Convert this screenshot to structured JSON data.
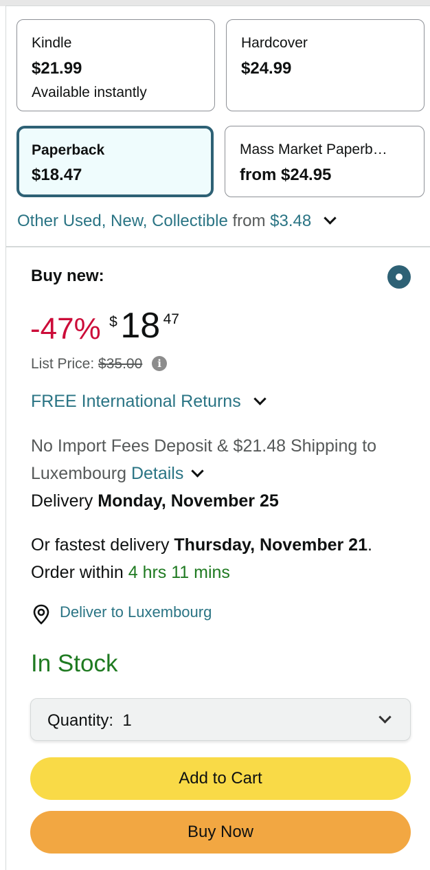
{
  "formats": [
    {
      "name": "Kindle",
      "price": "$21.99",
      "sub": "Available instantly",
      "selected": false
    },
    {
      "name": "Hardcover",
      "price": "$24.99",
      "sub": "",
      "selected": false
    },
    {
      "name": "Paperback",
      "price": "$18.47",
      "sub": "",
      "selected": true
    },
    {
      "name": "Mass Market Paperb…",
      "price": "from $24.95",
      "sub": "",
      "selected": false
    }
  ],
  "other_offers": {
    "link_text": "Other Used, New, Collectible",
    "from_text": "from",
    "price": "$3.48"
  },
  "buy_new": {
    "label": "Buy new:",
    "discount": "-47%",
    "currency": "$",
    "price_whole": "18",
    "price_fraction": "47",
    "list_price_label": "List Price:",
    "list_price": "$35.00",
    "info_icon": "i"
  },
  "returns": "FREE International Returns",
  "shipping": {
    "line1": "No Import Fees Deposit & $21.48 Shipping to Luxembourg",
    "details_link": "Details",
    "delivery_label": "Delivery",
    "delivery_date": "Monday, November 25",
    "fastest_prefix": "Or fastest delivery",
    "fastest_date": "Thursday, November 21",
    "order_within": ". Order within",
    "countdown": "4 hrs 11 mins"
  },
  "deliver_to": "Deliver to Luxembourg",
  "stock_status": "In Stock",
  "quantity": {
    "label": "Quantity:",
    "value": "1"
  },
  "buttons": {
    "add_to_cart": "Add to Cart",
    "buy_now": "Buy Now"
  },
  "colors": {
    "link": "#2a7484",
    "discount": "#cc0c39",
    "in_stock": "#1f7a21",
    "add_to_cart": "#f9da47",
    "buy_now": "#f2a742",
    "selected_border": "#2e6175"
  }
}
